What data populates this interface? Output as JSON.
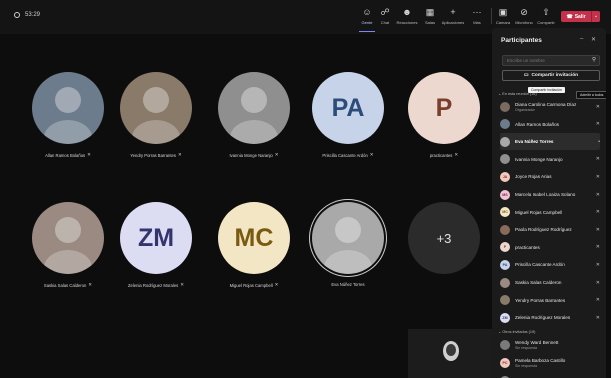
{
  "meeting": {
    "timer": "53:29"
  },
  "toolbar": {
    "people": "Gente",
    "chat": "Chat",
    "reactions": "Reacciones",
    "rooms": "Salas",
    "apps": "Aplicaciones",
    "more": "Más",
    "camera": "Cámara",
    "mic": "Micrófono",
    "share": "Compartir",
    "leave": "Salir"
  },
  "stage": {
    "tiles": [
      {
        "name": "Allan Ramos Bolaños",
        "initials": "",
        "bg": "#6d7c8c"
      },
      {
        "name": "Yendry Porras Barrantes",
        "initials": "",
        "bg": "#8a7a6a"
      },
      {
        "name": "Ivannia Monge Naranjo",
        "initials": "",
        "bg": "#8f8f8f"
      },
      {
        "name": "Priscilla Cascante Ardón",
        "initials": "PA",
        "bg": "#c6d3e8",
        "fg": "#2e4c7a"
      },
      {
        "name": "practicantes",
        "initials": "P",
        "bg": "#ecd8cf",
        "fg": "#7a3e2c"
      },
      {
        "name": "Saskia Salas Calderon",
        "initials": "",
        "bg": "#9a8a82"
      },
      {
        "name": "Zelenia Rodríguez Morales",
        "initials": "ZM",
        "bg": "#dcdcf3",
        "fg": "#35356e"
      },
      {
        "name": "Miguel Rojas Campbell",
        "initials": "MC",
        "bg": "#f3e6c4",
        "fg": "#7a5a10"
      },
      {
        "name": "Eva Núñez Torres",
        "initials": "",
        "bg": "#a9a9a9"
      },
      {
        "name": "",
        "initials": "+3",
        "bg": "#2b2b2b",
        "fg": "#e0e0e0"
      }
    ]
  },
  "panel": {
    "title": "Participantes",
    "search_placeholder": "Escribe un nombre",
    "invite_label": "Compartir invitación",
    "in_meeting_header": "En esta reunión (16)",
    "tooltip": "Compartir invitación",
    "admit_label": "Admitir a todos",
    "invited_header": "Otros invitados (19)",
    "participants": [
      {
        "name": "Diana Carolina Carmona Díaz",
        "sub": "Organizador",
        "initials": "",
        "bg": "#7b6a5f"
      },
      {
        "name": "Allan Ramos Bolaños",
        "sub": "",
        "initials": "",
        "bg": "#6d7c8c"
      },
      {
        "name": "Eva Núñez Torres",
        "sub": "",
        "initials": "",
        "bg": "#a9a9a9",
        "bold": true
      },
      {
        "name": "Ivannia Monge Naranjo",
        "sub": "",
        "initials": "",
        "bg": "#8f8f8f"
      },
      {
        "name": "Joyce Rojas Arias",
        "sub": "",
        "initials": "JA",
        "bg": "#f1c9c0",
        "fg": "#8a2c1b"
      },
      {
        "name": "Marcela Isabel Loaiza Solano",
        "sub": "",
        "initials": "MS",
        "bg": "#f0c4d4",
        "fg": "#8a1f48"
      },
      {
        "name": "Miguel Rojas Campbell",
        "sub": "",
        "initials": "MC",
        "bg": "#f3e6c4",
        "fg": "#7a5a10"
      },
      {
        "name": "Paola Rodríguez Rodríguez",
        "sub": "",
        "initials": "",
        "bg": "#8a6a5a"
      },
      {
        "name": "practicantes",
        "sub": "",
        "initials": "P",
        "bg": "#ecd8cf",
        "fg": "#7a3e2c"
      },
      {
        "name": "Priscilla Cascante Ardón",
        "sub": "",
        "initials": "PA",
        "bg": "#c6d3e8",
        "fg": "#2e4c7a"
      },
      {
        "name": "Saskia Salas Calderon",
        "sub": "",
        "initials": "",
        "bg": "#9a8a82"
      },
      {
        "name": "Yendry Porras Barrantes",
        "sub": "",
        "initials": "",
        "bg": "#8a7a6a"
      },
      {
        "name": "Zelenia Rodríguez Morales",
        "sub": "",
        "initials": "ZM",
        "bg": "#dcdcf3",
        "fg": "#35356e"
      }
    ],
    "invited": [
      {
        "name": "Wendy Ward Bennett",
        "sub": "Sin respuesta",
        "initials": "",
        "bg": "#7a7a7a"
      },
      {
        "name": "Pamela Barboza Castillo",
        "sub": "Sin respuesta",
        "initials": "PC",
        "bg": "#f1c9c0",
        "fg": "#8a2c1b"
      },
      {
        "name": "Giovanna Montero Arce",
        "sub": "",
        "initials": "",
        "bg": "#8a8a8a"
      }
    ]
  },
  "colors": {
    "accent": "#7f85f5",
    "leave": "#c4314b",
    "panel": "#1b1b1b",
    "stage": "#0d0d0d"
  }
}
